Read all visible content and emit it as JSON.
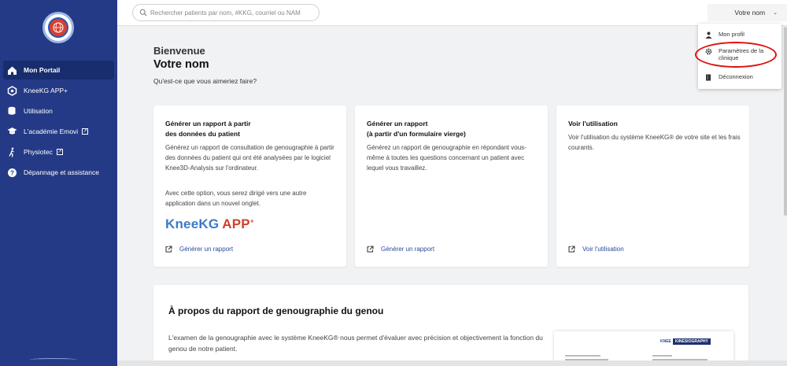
{
  "sidebar": {
    "items": [
      {
        "label": "Mon Portail",
        "icon": "home-icon",
        "active": true,
        "external": false
      },
      {
        "label": "KneeKG APP+",
        "icon": "hexagon-icon",
        "active": false,
        "external": false
      },
      {
        "label": "Utilisation",
        "icon": "database-icon",
        "active": false,
        "external": false
      },
      {
        "label": "L'académie Emovi",
        "icon": "graduation-cap-icon",
        "active": false,
        "external": true
      },
      {
        "label": "Physiotec",
        "icon": "running-person-icon",
        "active": false,
        "external": true
      },
      {
        "label": "Dépannage et assistance",
        "icon": "help-circle-icon",
        "active": false,
        "external": false
      }
    ]
  },
  "header": {
    "search_placeholder": "Rechercher patients par nom, #KKG, courriel ou NAM",
    "user_label": "Votre nom"
  },
  "user_dropdown": {
    "items": [
      {
        "label": "Mon profil",
        "icon": "user-icon"
      },
      {
        "label": "Paramètres de la clinique",
        "icon": "gear-icon"
      },
      {
        "label": "Déconnexion",
        "icon": "logout-icon"
      }
    ]
  },
  "main": {
    "welcome": "Bienvenue",
    "name": "Votre nom",
    "question": "Qu'est-ce que vous aimeriez faire?",
    "cards": [
      {
        "title_line1": "Générer un rapport à partir",
        "title_line2": "des données du patient",
        "description": "Générez un rapport de consultation de genougraphie à partir des données du patient qui ont été analysées par le logiciel Knee3D-Analysis sur l'ordinateur.",
        "description2": "Avec cette option, vous serez dirigé vers une autre application dans un nouvel onglet.",
        "logo_knee": "Knee",
        "logo_kg": "KG",
        "logo_app": "APP",
        "action": "Générer un rapport"
      },
      {
        "title_line1": "Générer un rapport",
        "title_line2": "(à partir d'un formulaire vierge)",
        "description": "Générez un rapport de genougraphie en répondant vous-même à toutes les questions concernant un patient avec lequel vous travaillez.",
        "action": "Générer un rapport"
      },
      {
        "title_line1": "Voir l'utilisation",
        "description": "Voir l'utilisation du système KneeKG® de votre site et les frais courants.",
        "action": "Voir l'utilisation"
      }
    ],
    "about": {
      "title": "À propos du rapport de genougraphie du genou",
      "text": "L'examen de la genougraphie avec le système KneeKG® nous permet d'évaluer avec précision et objectivement la fonction du genou de notre patient.",
      "thumb_knee": "KNEE",
      "thumb_kinesio": "KINESIOGRAPHY"
    }
  },
  "colors": {
    "sidebar_bg": "#253a86",
    "sidebar_active": "#172d6e",
    "link": "#2a4a9a",
    "highlight_circle": "#e01010"
  }
}
